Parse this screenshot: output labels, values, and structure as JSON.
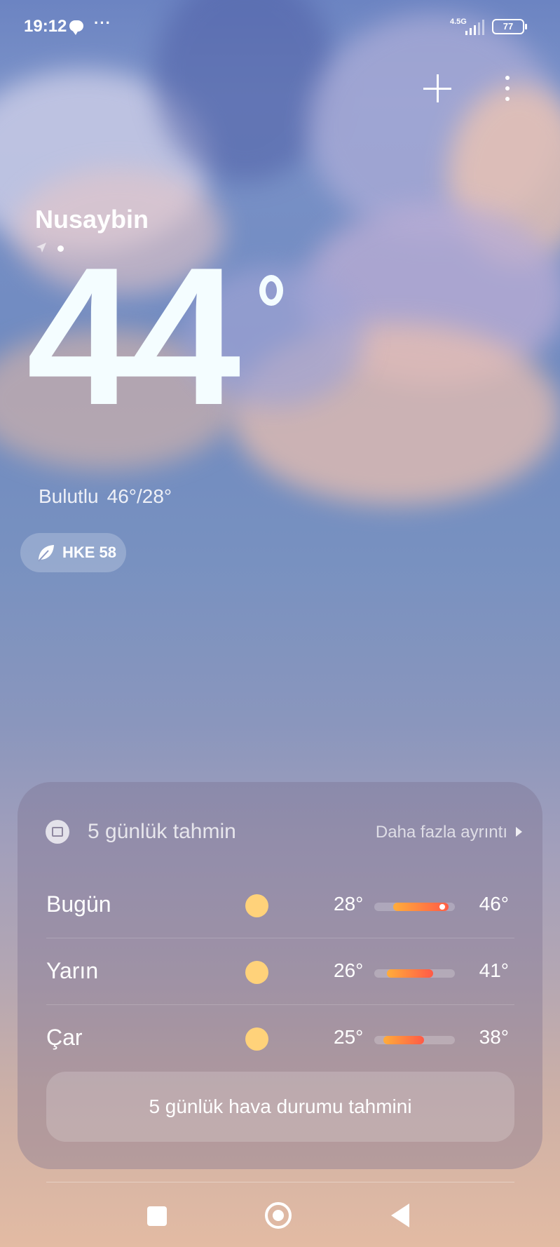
{
  "status_bar": {
    "time": "19:12",
    "network": "4.5G",
    "battery": "77",
    "notification_icons": [
      "chat-bubble-icon",
      "more-dots-icon"
    ]
  },
  "header": {
    "actions": [
      "add-city",
      "more-options"
    ]
  },
  "current": {
    "city": "Nusaybin",
    "temperature": "44",
    "condition": "Bulutlu",
    "high_low": "46°/28°",
    "aqi_label": "HKE 58"
  },
  "forecast": {
    "title": "5 günlük tahmin",
    "more_link": "Daha fazla ayrıntı",
    "days": [
      {
        "day": "Bugün",
        "icon": "sun-icon",
        "low": "28°",
        "high": "46°",
        "low_val": 28,
        "high_val": 46,
        "current_val": 44
      },
      {
        "day": "Yarın",
        "icon": "sun-icon",
        "low": "26°",
        "high": "41°",
        "low_val": 26,
        "high_val": 41
      },
      {
        "day": "Çar",
        "icon": "sun-icon",
        "low": "25°",
        "high": "38°",
        "low_val": 25,
        "high_val": 38
      }
    ],
    "range_min": 22,
    "range_max": 48,
    "button_label": "5 günlük hava durumu tahmini"
  },
  "colors": {
    "sky_top": "#6c84c2",
    "sky_bottom": "#e3bba3",
    "sun": "#ffd27a",
    "bar_start": "#ffad3b",
    "bar_end": "#ff5a47"
  }
}
